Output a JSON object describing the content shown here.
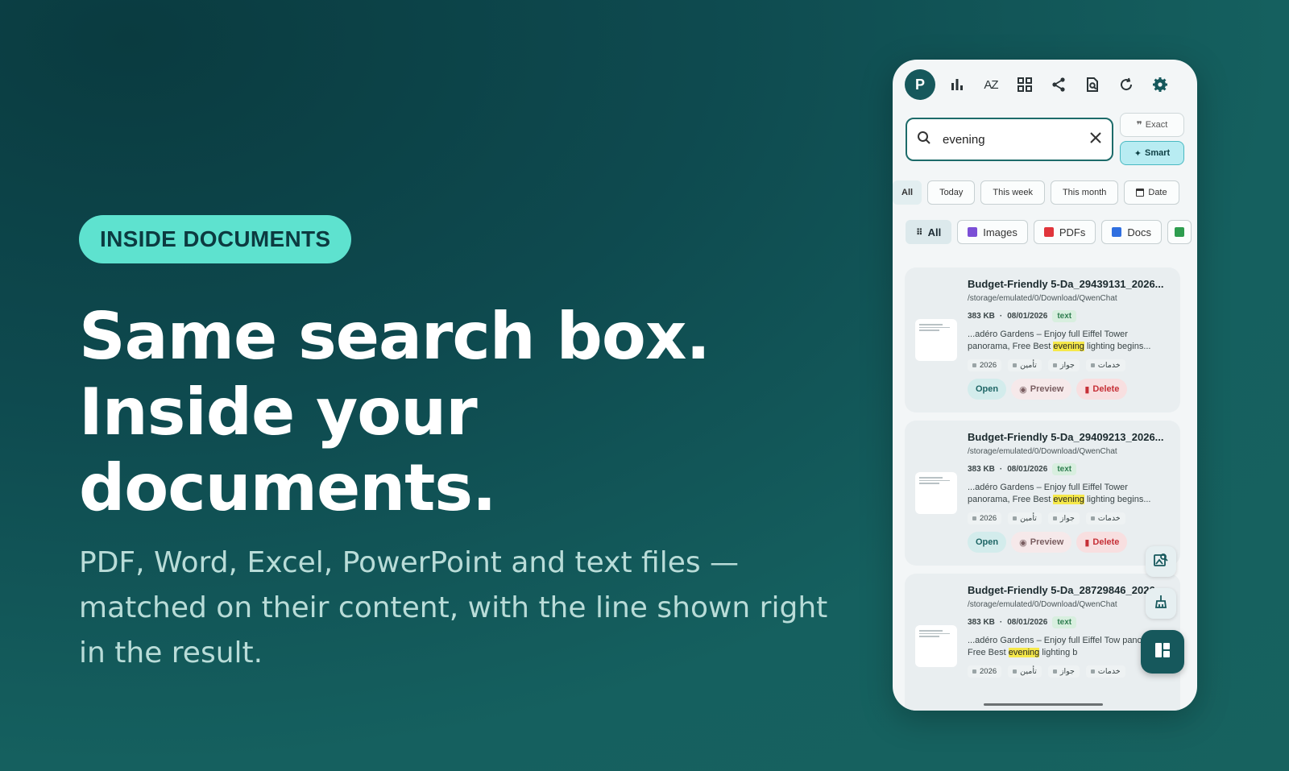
{
  "hero": {
    "badge": "INSIDE DOCUMENTS",
    "headline": "Same search box. Inside your documents.",
    "subtitle": "PDF, Word, Excel, PowerPoint and text files — matched on their content, with the line shown right in the result."
  },
  "app": {
    "avatar": "P",
    "toolbar_icons": [
      "bar-chart-icon",
      "sort-az-icon",
      "grid-icon",
      "share-icon",
      "doc-search-icon",
      "refresh-icon",
      "settings-icon"
    ],
    "sort_label": "AZ",
    "search": {
      "value": "evening"
    },
    "modes": {
      "exact": "Exact",
      "smart": "Smart"
    },
    "date_filters": [
      "All",
      "Today",
      "This week",
      "This month",
      "Date"
    ],
    "type_filters": [
      "All",
      "Images",
      "PDFs",
      "Docs"
    ],
    "results": [
      {
        "name": "Budget-Friendly 5-Da_29439131_2026...",
        "path": "/storage/emulated/0/Download/QwenChat",
        "size": "383 KB",
        "date": "08/01/2026",
        "badge": "text",
        "snippet_before": "...adéro Gardens – Enjoy full Eiffel Tower panorama, Free Best ",
        "snippet_match": "evening",
        "snippet_after": " lighting begins...",
        "tags": [
          "2026",
          "تأمين",
          "جواز",
          "خدمات"
        ],
        "actions": {
          "open": "Open",
          "preview": "Preview",
          "delete": "Delete"
        }
      },
      {
        "name": "Budget-Friendly 5-Da_29409213_2026...",
        "path": "/storage/emulated/0/Download/QwenChat",
        "size": "383 KB",
        "date": "08/01/2026",
        "badge": "text",
        "snippet_before": "...adéro Gardens – Enjoy full Eiffel Tower panorama, Free Best ",
        "snippet_match": "evening",
        "snippet_after": " lighting begins...",
        "tags": [
          "2026",
          "تأمين",
          "جواز",
          "خدمات"
        ],
        "actions": {
          "open": "Open",
          "preview": "Preview",
          "delete": "Delete"
        }
      },
      {
        "name": "Budget-Friendly 5-Da_28729846_2026",
        "path": "/storage/emulated/0/Download/QwenChat",
        "size": "383 KB",
        "date": "08/01/2026",
        "badge": "text",
        "snippet_before": "...adéro Gardens – Enjoy full Eiffel Tow panorama, Free Best ",
        "snippet_match": "evening",
        "snippet_after": " lighting b",
        "tags": [
          "2026",
          "تأمين",
          "جواز",
          "خدمات"
        ]
      }
    ],
    "meta_separator": "·",
    "colors": {
      "accent": "#16585c",
      "badge_bg": "#5ee2cf",
      "highlight": "#f5e84a",
      "delete": "#c63037"
    }
  }
}
